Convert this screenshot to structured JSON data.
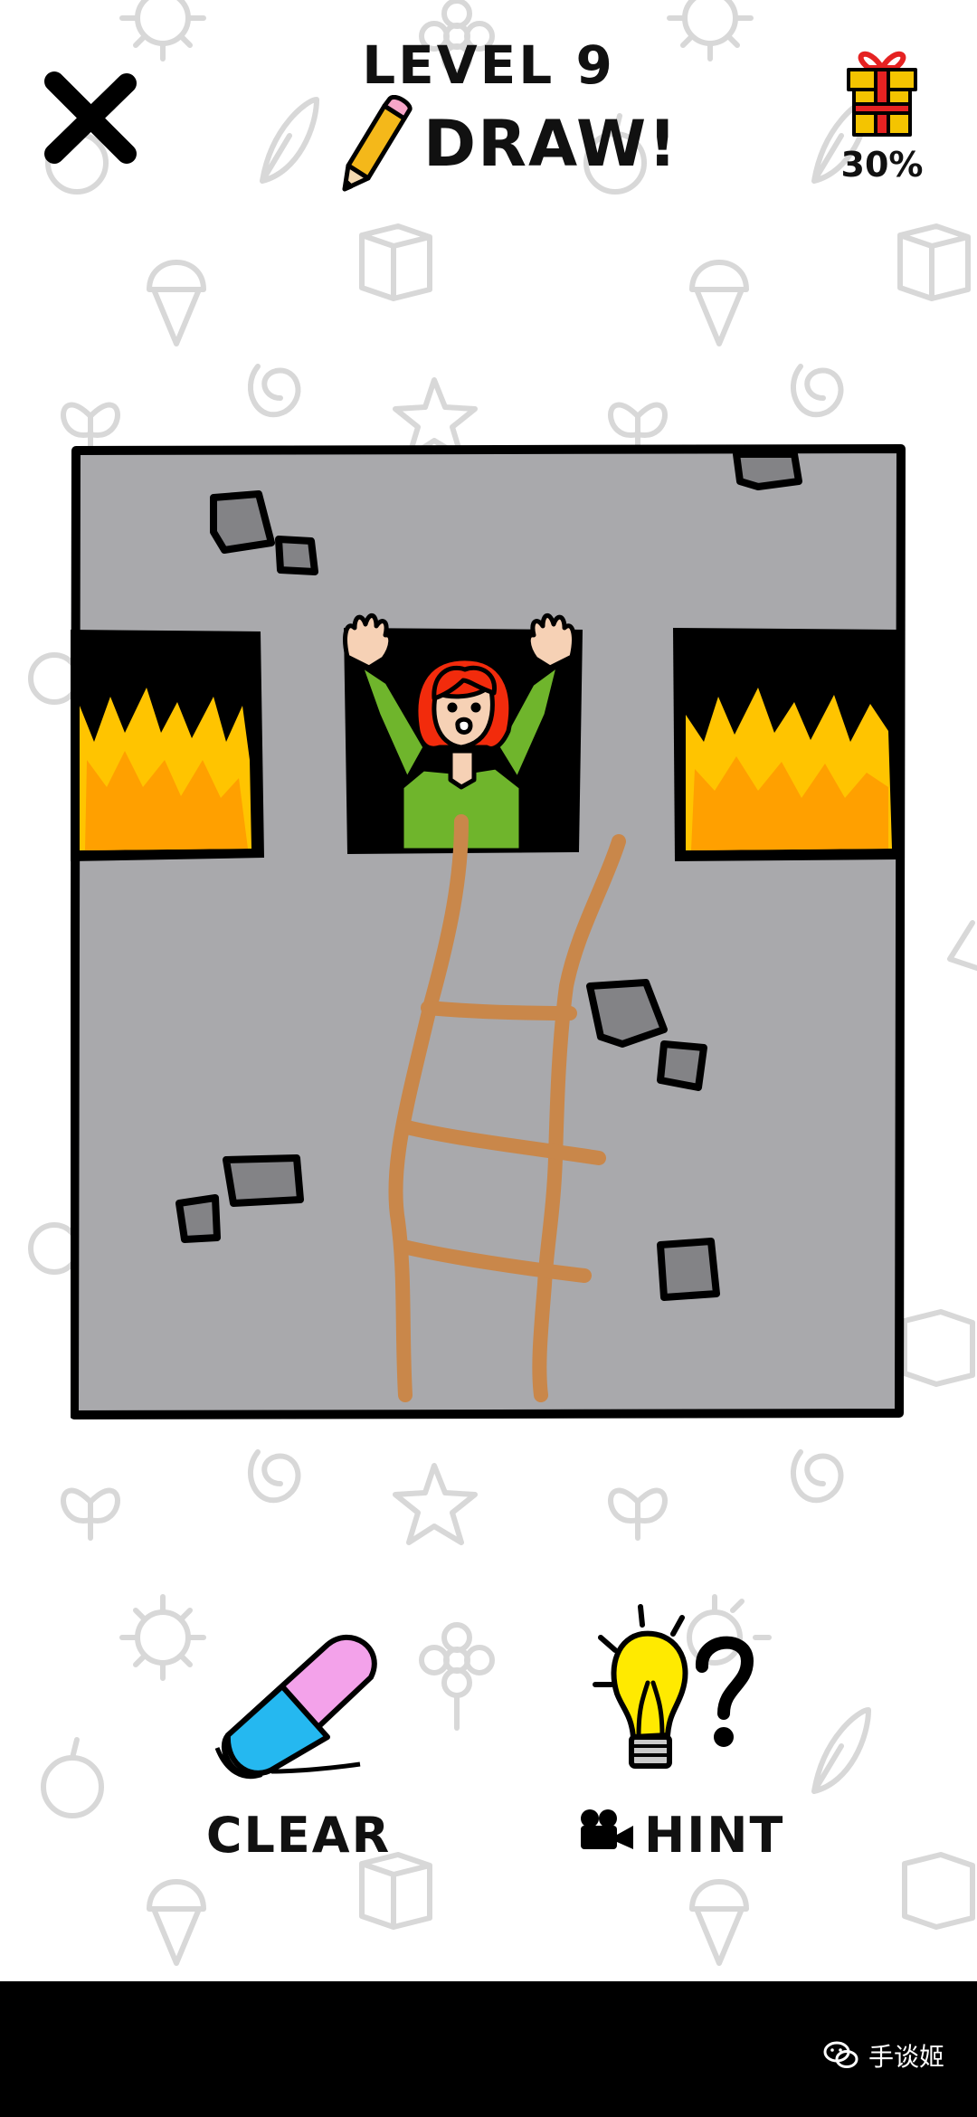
{
  "header": {
    "level_title": "LEVEL 9",
    "instruction": "DRAW!",
    "gift_progress": "30%"
  },
  "actions": {
    "clear_label": "CLEAR",
    "hint_label": "HINT"
  },
  "watermark": {
    "text": "手谈姬"
  },
  "icons": {
    "close": "close-icon",
    "pencil": "pencil-icon",
    "gift": "gift-icon",
    "eraser": "eraser-icon",
    "lightbulb": "lightbulb-icon",
    "video": "video-camera-icon",
    "wechat": "wechat-icon"
  },
  "colors": {
    "wall": "#a9a9ac",
    "fire_outer": "#ffc400",
    "fire_inner": "#ffa000",
    "shirt": "#6fb52c",
    "hair": "#f22b0c",
    "ladder": "#c9874a",
    "eraser_pink": "#f3a2ea",
    "eraser_blue": "#25b8f0",
    "bulb": "#ffea00",
    "gift": "#f4c400"
  }
}
